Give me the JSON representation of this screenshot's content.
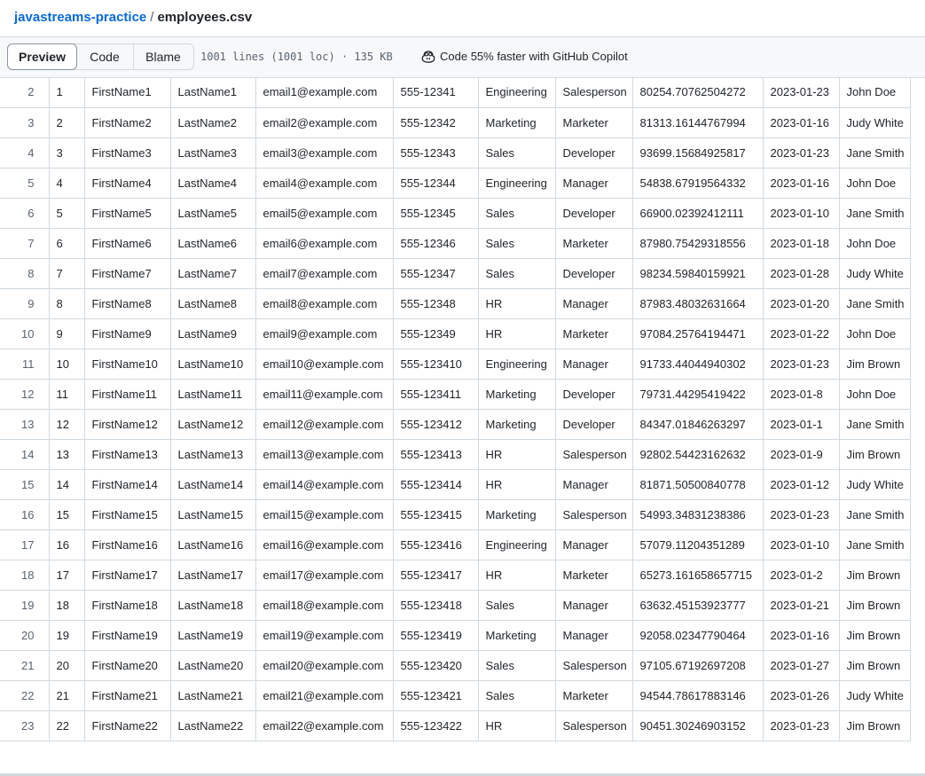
{
  "breadcrumb": {
    "repo": "javastreams-practice",
    "separator": "/",
    "file": "employees.csv"
  },
  "toolbar": {
    "preview_label": "Preview",
    "code_label": "Code",
    "blame_label": "Blame",
    "file_meta": "1001 lines (1001 loc) · 135 KB",
    "copilot_text": "Code 55% faster with GitHub Copilot",
    "copilot_icon": "copilot-icon"
  },
  "table": {
    "rows": [
      [
        "2",
        "1",
        "FirstName1",
        "LastName1",
        "email1@example.com",
        "555-12341",
        "Engineering",
        "Salesperson",
        "80254.70762504272",
        "2023-01-23",
        "John Doe"
      ],
      [
        "3",
        "2",
        "FirstName2",
        "LastName2",
        "email2@example.com",
        "555-12342",
        "Marketing",
        "Marketer",
        "81313.16144767994",
        "2023-01-16",
        "Judy White"
      ],
      [
        "4",
        "3",
        "FirstName3",
        "LastName3",
        "email3@example.com",
        "555-12343",
        "Sales",
        "Developer",
        "93699.15684925817",
        "2023-01-23",
        "Jane Smith"
      ],
      [
        "5",
        "4",
        "FirstName4",
        "LastName4",
        "email4@example.com",
        "555-12344",
        "Engineering",
        "Manager",
        "54838.67919564332",
        "2023-01-16",
        "John Doe"
      ],
      [
        "6",
        "5",
        "FirstName5",
        "LastName5",
        "email5@example.com",
        "555-12345",
        "Sales",
        "Developer",
        "66900.02392412111",
        "2023-01-10",
        "Jane Smith"
      ],
      [
        "7",
        "6",
        "FirstName6",
        "LastName6",
        "email6@example.com",
        "555-12346",
        "Sales",
        "Marketer",
        "87980.75429318556",
        "2023-01-18",
        "John Doe"
      ],
      [
        "8",
        "7",
        "FirstName7",
        "LastName7",
        "email7@example.com",
        "555-12347",
        "Sales",
        "Developer",
        "98234.59840159921",
        "2023-01-28",
        "Judy White"
      ],
      [
        "9",
        "8",
        "FirstName8",
        "LastName8",
        "email8@example.com",
        "555-12348",
        "HR",
        "Manager",
        "87983.48032631664",
        "2023-01-20",
        "Jane Smith"
      ],
      [
        "10",
        "9",
        "FirstName9",
        "LastName9",
        "email9@example.com",
        "555-12349",
        "HR",
        "Marketer",
        "97084.25764194471",
        "2023-01-22",
        "John Doe"
      ],
      [
        "11",
        "10",
        "FirstName10",
        "LastName10",
        "email10@example.com",
        "555-123410",
        "Engineering",
        "Manager",
        "91733.44044940302",
        "2023-01-23",
        "Jim Brown"
      ],
      [
        "12",
        "11",
        "FirstName11",
        "LastName11",
        "email11@example.com",
        "555-123411",
        "Marketing",
        "Developer",
        "79731.44295419422",
        "2023-01-8",
        "John Doe"
      ],
      [
        "13",
        "12",
        "FirstName12",
        "LastName12",
        "email12@example.com",
        "555-123412",
        "Marketing",
        "Developer",
        "84347.01846263297",
        "2023-01-1",
        "Jane Smith"
      ],
      [
        "14",
        "13",
        "FirstName13",
        "LastName13",
        "email13@example.com",
        "555-123413",
        "HR",
        "Salesperson",
        "92802.54423162632",
        "2023-01-9",
        "Jim Brown"
      ],
      [
        "15",
        "14",
        "FirstName14",
        "LastName14",
        "email14@example.com",
        "555-123414",
        "HR",
        "Manager",
        "81871.50500840778",
        "2023-01-12",
        "Judy White"
      ],
      [
        "16",
        "15",
        "FirstName15",
        "LastName15",
        "email15@example.com",
        "555-123415",
        "Marketing",
        "Salesperson",
        "54993.34831238386",
        "2023-01-23",
        "Jane Smith"
      ],
      [
        "17",
        "16",
        "FirstName16",
        "LastName16",
        "email16@example.com",
        "555-123416",
        "Engineering",
        "Manager",
        "57079.11204351289",
        "2023-01-10",
        "Jane Smith"
      ],
      [
        "18",
        "17",
        "FirstName17",
        "LastName17",
        "email17@example.com",
        "555-123417",
        "HR",
        "Marketer",
        "65273.161658657715",
        "2023-01-2",
        "Jim Brown"
      ],
      [
        "19",
        "18",
        "FirstName18",
        "LastName18",
        "email18@example.com",
        "555-123418",
        "Sales",
        "Manager",
        "63632.45153923777",
        "2023-01-21",
        "Jim Brown"
      ],
      [
        "20",
        "19",
        "FirstName19",
        "LastName19",
        "email19@example.com",
        "555-123419",
        "Marketing",
        "Manager",
        "92058.02347790464",
        "2023-01-16",
        "Jim Brown"
      ],
      [
        "21",
        "20",
        "FirstName20",
        "LastName20",
        "email20@example.com",
        "555-123420",
        "Sales",
        "Salesperson",
        "97105.67192697208",
        "2023-01-27",
        "Jim Brown"
      ],
      [
        "22",
        "21",
        "FirstName21",
        "LastName21",
        "email21@example.com",
        "555-123421",
        "Sales",
        "Marketer",
        "94544.78617883146",
        "2023-01-26",
        "Judy White"
      ],
      [
        "23",
        "22",
        "FirstName22",
        "LastName22",
        "email22@example.com",
        "555-123422",
        "HR",
        "Salesperson",
        "90451.30246903152",
        "2023-01-23",
        "Jim Brown"
      ]
    ]
  }
}
